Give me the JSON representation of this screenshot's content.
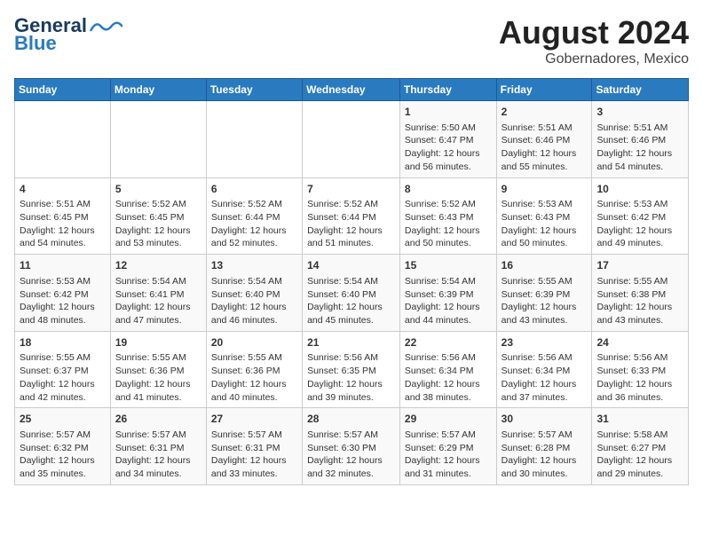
{
  "header": {
    "logo_general": "General",
    "logo_blue": "Blue",
    "title": "August 2024",
    "subtitle": "Gobernadores, Mexico"
  },
  "days_of_week": [
    "Sunday",
    "Monday",
    "Tuesday",
    "Wednesday",
    "Thursday",
    "Friday",
    "Saturday"
  ],
  "weeks": [
    [
      {
        "day": "",
        "content": ""
      },
      {
        "day": "",
        "content": ""
      },
      {
        "day": "",
        "content": ""
      },
      {
        "day": "",
        "content": ""
      },
      {
        "day": "1",
        "content": "Sunrise: 5:50 AM\nSunset: 6:47 PM\nDaylight: 12 hours\nand 56 minutes."
      },
      {
        "day": "2",
        "content": "Sunrise: 5:51 AM\nSunset: 6:46 PM\nDaylight: 12 hours\nand 55 minutes."
      },
      {
        "day": "3",
        "content": "Sunrise: 5:51 AM\nSunset: 6:46 PM\nDaylight: 12 hours\nand 54 minutes."
      }
    ],
    [
      {
        "day": "4",
        "content": "Sunrise: 5:51 AM\nSunset: 6:45 PM\nDaylight: 12 hours\nand 54 minutes."
      },
      {
        "day": "5",
        "content": "Sunrise: 5:52 AM\nSunset: 6:45 PM\nDaylight: 12 hours\nand 53 minutes."
      },
      {
        "day": "6",
        "content": "Sunrise: 5:52 AM\nSunset: 6:44 PM\nDaylight: 12 hours\nand 52 minutes."
      },
      {
        "day": "7",
        "content": "Sunrise: 5:52 AM\nSunset: 6:44 PM\nDaylight: 12 hours\nand 51 minutes."
      },
      {
        "day": "8",
        "content": "Sunrise: 5:52 AM\nSunset: 6:43 PM\nDaylight: 12 hours\nand 50 minutes."
      },
      {
        "day": "9",
        "content": "Sunrise: 5:53 AM\nSunset: 6:43 PM\nDaylight: 12 hours\nand 50 minutes."
      },
      {
        "day": "10",
        "content": "Sunrise: 5:53 AM\nSunset: 6:42 PM\nDaylight: 12 hours\nand 49 minutes."
      }
    ],
    [
      {
        "day": "11",
        "content": "Sunrise: 5:53 AM\nSunset: 6:42 PM\nDaylight: 12 hours\nand 48 minutes."
      },
      {
        "day": "12",
        "content": "Sunrise: 5:54 AM\nSunset: 6:41 PM\nDaylight: 12 hours\nand 47 minutes."
      },
      {
        "day": "13",
        "content": "Sunrise: 5:54 AM\nSunset: 6:40 PM\nDaylight: 12 hours\nand 46 minutes."
      },
      {
        "day": "14",
        "content": "Sunrise: 5:54 AM\nSunset: 6:40 PM\nDaylight: 12 hours\nand 45 minutes."
      },
      {
        "day": "15",
        "content": "Sunrise: 5:54 AM\nSunset: 6:39 PM\nDaylight: 12 hours\nand 44 minutes."
      },
      {
        "day": "16",
        "content": "Sunrise: 5:55 AM\nSunset: 6:39 PM\nDaylight: 12 hours\nand 43 minutes."
      },
      {
        "day": "17",
        "content": "Sunrise: 5:55 AM\nSunset: 6:38 PM\nDaylight: 12 hours\nand 43 minutes."
      }
    ],
    [
      {
        "day": "18",
        "content": "Sunrise: 5:55 AM\nSunset: 6:37 PM\nDaylight: 12 hours\nand 42 minutes."
      },
      {
        "day": "19",
        "content": "Sunrise: 5:55 AM\nSunset: 6:36 PM\nDaylight: 12 hours\nand 41 minutes."
      },
      {
        "day": "20",
        "content": "Sunrise: 5:55 AM\nSunset: 6:36 PM\nDaylight: 12 hours\nand 40 minutes."
      },
      {
        "day": "21",
        "content": "Sunrise: 5:56 AM\nSunset: 6:35 PM\nDaylight: 12 hours\nand 39 minutes."
      },
      {
        "day": "22",
        "content": "Sunrise: 5:56 AM\nSunset: 6:34 PM\nDaylight: 12 hours\nand 38 minutes."
      },
      {
        "day": "23",
        "content": "Sunrise: 5:56 AM\nSunset: 6:34 PM\nDaylight: 12 hours\nand 37 minutes."
      },
      {
        "day": "24",
        "content": "Sunrise: 5:56 AM\nSunset: 6:33 PM\nDaylight: 12 hours\nand 36 minutes."
      }
    ],
    [
      {
        "day": "25",
        "content": "Sunrise: 5:57 AM\nSunset: 6:32 PM\nDaylight: 12 hours\nand 35 minutes."
      },
      {
        "day": "26",
        "content": "Sunrise: 5:57 AM\nSunset: 6:31 PM\nDaylight: 12 hours\nand 34 minutes."
      },
      {
        "day": "27",
        "content": "Sunrise: 5:57 AM\nSunset: 6:31 PM\nDaylight: 12 hours\nand 33 minutes."
      },
      {
        "day": "28",
        "content": "Sunrise: 5:57 AM\nSunset: 6:30 PM\nDaylight: 12 hours\nand 32 minutes."
      },
      {
        "day": "29",
        "content": "Sunrise: 5:57 AM\nSunset: 6:29 PM\nDaylight: 12 hours\nand 31 minutes."
      },
      {
        "day": "30",
        "content": "Sunrise: 5:57 AM\nSunset: 6:28 PM\nDaylight: 12 hours\nand 30 minutes."
      },
      {
        "day": "31",
        "content": "Sunrise: 5:58 AM\nSunset: 6:27 PM\nDaylight: 12 hours\nand 29 minutes."
      }
    ]
  ]
}
